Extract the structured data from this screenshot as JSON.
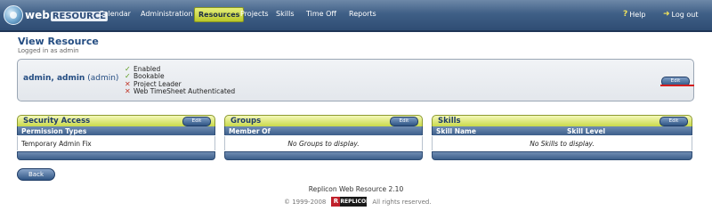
{
  "app": {
    "logo_web": "web",
    "logo_resource": "RESOURCE"
  },
  "nav": {
    "calendar": "Calendar",
    "administration": "Administration",
    "resources": "Resources",
    "projects": "Projects",
    "skills": "Skills",
    "time_off": "Time Off",
    "reports": "Reports",
    "help": "Help",
    "logout": "Log out"
  },
  "page": {
    "title": "View Resource",
    "subtitle": "Logged in as admin"
  },
  "resource": {
    "name": "admin, admin",
    "login": "(admin)",
    "statuses": [
      {
        "label": "Enabled",
        "state": "yes"
      },
      {
        "label": "Bookable",
        "state": "yes"
      },
      {
        "label": "Project Leader",
        "state": "no"
      },
      {
        "label": "Web TimeSheet Authenticated",
        "state": "no"
      }
    ],
    "edit_label": "Edit",
    "highlight_color": "#d41d1d"
  },
  "sections": {
    "security": {
      "title": "Security Access",
      "edit_label": "Edit",
      "column": "Permission Types",
      "row": "Temporary Admin Fix"
    },
    "groups": {
      "title": "Groups",
      "edit_label": "Edit",
      "column": "Member Of",
      "empty": "No Groups to display."
    },
    "skills": {
      "title": "Skills",
      "edit_label": "Edit",
      "column_name": "Skill Name",
      "column_level": "Skill Level",
      "empty": "No Skills to display."
    }
  },
  "back_label": "Back",
  "footer": {
    "product": "Replicon Web Resource 2.10",
    "copyright": "© 1999-2008",
    "logo": "REPLICON",
    "rights": "All rights reserved."
  },
  "icons": {
    "help": "question-mark-icon",
    "logout": "arrow-exit-icon",
    "status_yes": "checkmark-icon",
    "status_no": "cross-icon"
  },
  "colors": {
    "nav_bar": "#3f5f86",
    "active_tab": "#d4de4a",
    "heading_blue": "#244d82",
    "section_header": "#c9d94a"
  }
}
